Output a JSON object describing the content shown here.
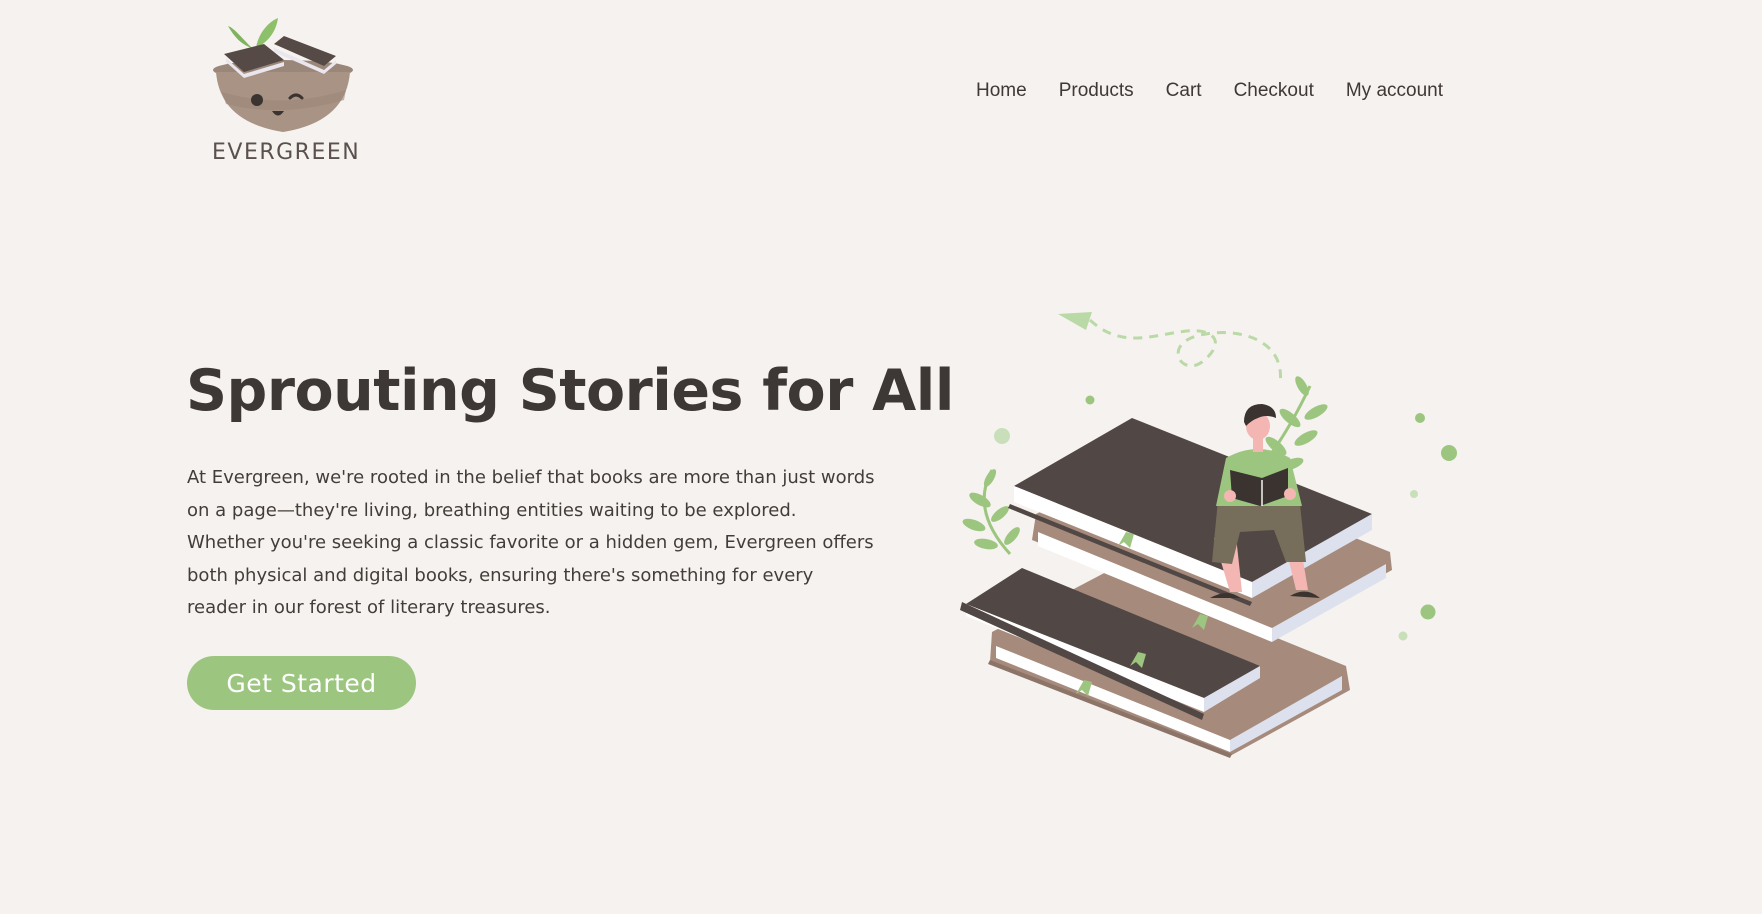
{
  "brand": {
    "name": "EVERGREEN",
    "colors": {
      "background": "#f6f2ef",
      "accent": "#9cc67f",
      "text": "#3d3735"
    }
  },
  "nav": {
    "items": [
      {
        "label": "Home"
      },
      {
        "label": "Products"
      },
      {
        "label": "Cart"
      },
      {
        "label": "Checkout"
      },
      {
        "label": "My account"
      }
    ]
  },
  "hero": {
    "title": "Sprouting Stories for All",
    "body": "At Evergreen, we're rooted in the belief that books are more than just words on a page—they're living, breathing entities waiting to be explored. Whether you're seeking a classic favorite or a hidden gem, Evergreen offers both physical and digital books, ensuring there's something for every reader in our forest of literary treasures.",
    "cta_label": "Get Started",
    "illustration": "person-reading-on-book-stack-illustration"
  }
}
